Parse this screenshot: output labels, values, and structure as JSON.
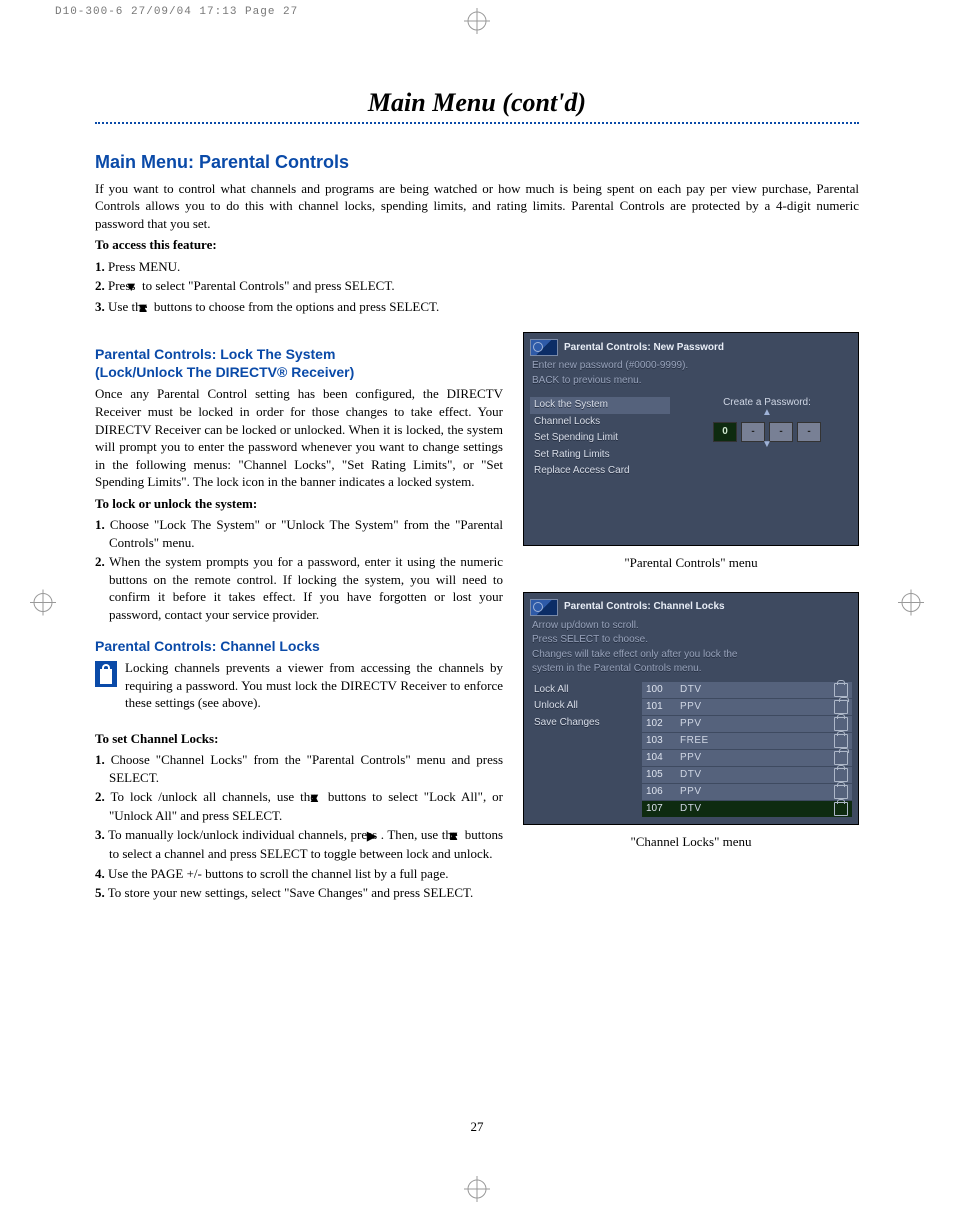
{
  "slug": "D10-300-6  27/09/04  17:13  Page 27",
  "page_title": "Main Menu (cont'd)",
  "page_number": "27",
  "section": {
    "heading": "Main Menu: Parental Controls",
    "intro": "If you want to control what channels and programs are being watched or how much is being spent on each pay per view purchase, Parental Controls allows you to do this with channel locks, spending limits, and rating limits. Parental Controls are protected by a 4-digit numeric password that you set.",
    "access_label": "To access this feature:",
    "access_steps": {
      "s1": "Press MENU.",
      "s2a": "Press ",
      "s2b": " to select \"Parental Controls\" and press SELECT.",
      "s3a": "Use the ",
      "s3b": " buttons to choose from the options and press SELECT."
    }
  },
  "lock_section": {
    "heading": "Parental Controls: Lock The System\n(Lock/Unlock The DIRECTV® Receiver)",
    "para": "Once any Parental Control setting has been configured, the DIRECTV Receiver must be locked in order for those changes to take effect. Your DIRECTV Receiver can be locked or unlocked. When it is locked, the system will prompt you to enter the password whenever you want to change settings in the following menus: \"Channel Locks\", \"Set Rating Limits\", or \"Set Spending Limits\". The lock icon in the banner indicates a locked system.",
    "howto_label": "To lock or unlock the system:",
    "steps": {
      "s1": "Choose \"Lock The System\" or \"Unlock The System\" from the \"Parental Controls\" menu.",
      "s2": "When the system prompts you for a password, enter it using the numeric buttons on the remote control. If locking the system, you will need to confirm it before it takes effect. If you have forgotten or lost your password, contact your service provider."
    }
  },
  "chlock_section": {
    "heading": "Parental Controls: Channel Locks",
    "para": "Locking channels prevents a viewer from accessing the channels by requiring a password. You must lock the DIRECTV Receiver to enforce these settings (see above).",
    "howto_label": "To set Channel Locks:",
    "steps": {
      "s1": "Choose \"Channel Locks\" from the \"Parental Controls\" menu and press SELECT.",
      "s2a": "To lock /unlock all channels, use the ",
      "s2b": " buttons to select \"Lock All\", or \"Unlock All\" and press SELECT.",
      "s3a": "To manually lock/unlock individual channels, press ",
      "s3b": ". Then, use the ",
      "s3c": " buttons to select a channel and press SELECT to toggle between lock and unlock.",
      "s4": "Use the PAGE +/- buttons to scroll the channel list by a full page.",
      "s5": "To store your new settings, select \"Save Changes\" and press SELECT."
    }
  },
  "screen1": {
    "title": "Parental Controls: New Password",
    "sub1": "Enter new password (#0000-9999).",
    "sub2": "BACK to previous menu.",
    "menu": [
      "Lock  the System",
      "Channel Locks",
      "Set Spending Limit",
      "Set Rating Limits",
      "Replace Access Card"
    ],
    "right_label": "Create a Password:",
    "pw": [
      "0",
      "-",
      "-",
      "-"
    ],
    "caption": "\"Parental Controls\" menu"
  },
  "screen2": {
    "title": "Parental Controls: Channel Locks",
    "sub1": "Arrow up/down to scroll.",
    "sub2": "Press SELECT to choose.",
    "sub3": "Changes will take effect only after you lock the",
    "sub4": "system in the Parental Controls menu.",
    "menu": [
      "Lock All",
      "Unlock All",
      "Save Changes"
    ],
    "rows": [
      {
        "n": "100",
        "t": "DTV",
        "lock": true
      },
      {
        "n": "101",
        "t": "PPV",
        "lock": false
      },
      {
        "n": "102",
        "t": "PPV",
        "lock": true
      },
      {
        "n": "103",
        "t": "FREE",
        "lock": true
      },
      {
        "n": "104",
        "t": "PPV",
        "lock": false
      },
      {
        "n": "105",
        "t": "DTV",
        "lock": true
      },
      {
        "n": "106",
        "t": "PPV",
        "lock": true
      },
      {
        "n": "107",
        "t": "DTV",
        "lock": true,
        "cur": true
      }
    ],
    "caption": "\"Channel Locks\" menu"
  }
}
